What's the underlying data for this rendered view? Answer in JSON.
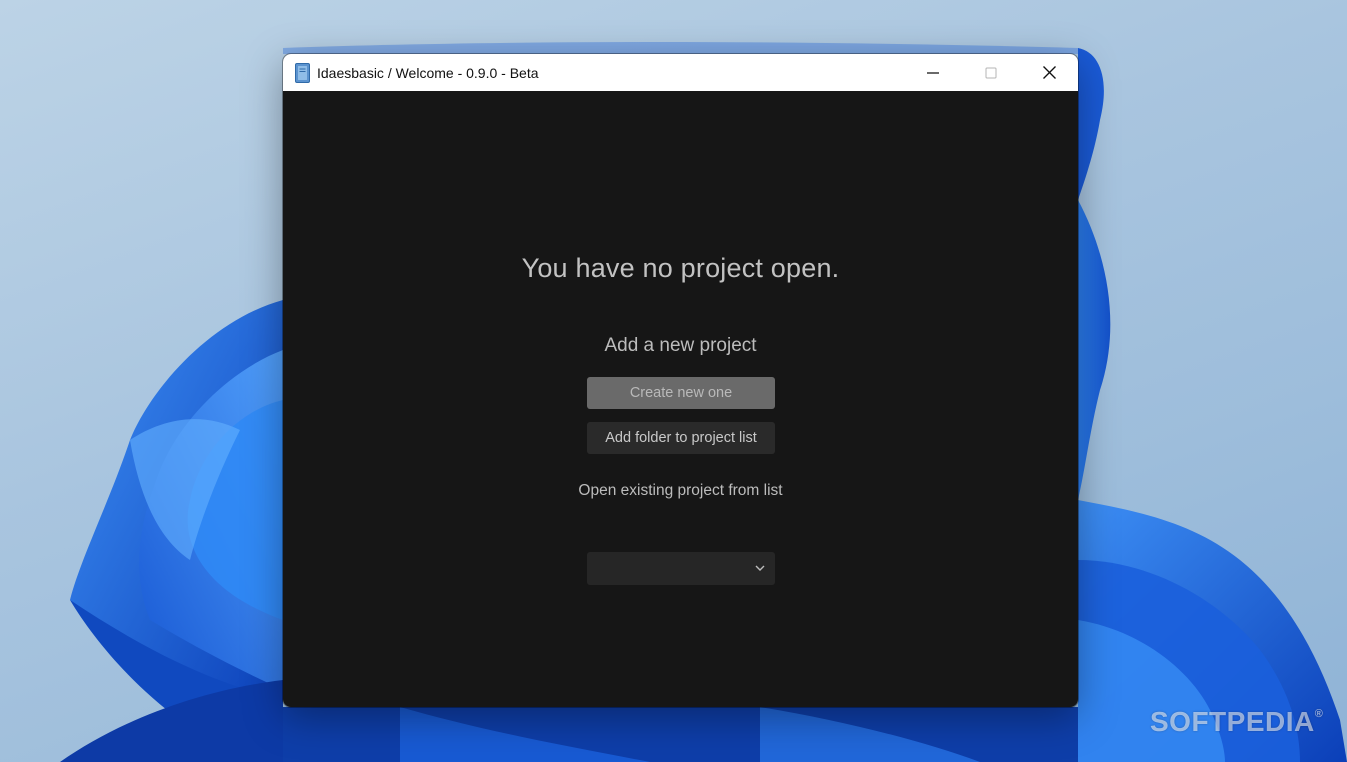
{
  "window": {
    "title": "Idaesbasic / Welcome - 0.9.0 - Beta",
    "app_icon": "notebook-icon",
    "controls": {
      "minimize_icon": "minimize-icon",
      "maximize_icon": "maximize-icon",
      "close_icon": "close-icon"
    }
  },
  "welcome": {
    "heading": "You have no project open.",
    "add_section_label": "Add a new project",
    "create_button_label": "Create new one",
    "add_folder_button_label": "Add folder to project list",
    "open_section_label": "Open existing project from list",
    "project_select": {
      "selected_value": "",
      "chevron_icon": "chevron-down-icon"
    }
  },
  "watermark": {
    "text": "SOFTPEDIA",
    "mark": "®"
  },
  "colors": {
    "window_bg": "#161616",
    "titlebar_bg": "#ffffff",
    "primary_button_bg": "#6a6a6a",
    "secondary_button_bg": "#2a2a2a",
    "accent_blue": "#1e6fe8"
  }
}
